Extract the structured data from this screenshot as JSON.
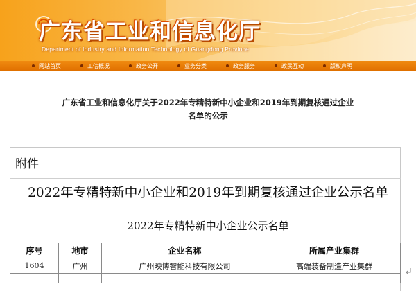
{
  "header": {
    "site_name": "广东省工业和信息化厅",
    "site_subtitle": "Department of Industry and Information Technology of Guangdong Province"
  },
  "nav": {
    "items": [
      {
        "label": "网站首页"
      },
      {
        "label": "工信概况"
      },
      {
        "label": "政务公开"
      },
      {
        "label": "业务分类"
      },
      {
        "label": "政务服务"
      },
      {
        "label": "政民互动"
      },
      {
        "label": "版权声明"
      }
    ]
  },
  "article": {
    "title_line1": "广东省工业和信息化厅关于2022年专精特新中小企业和2019年到期复核通过企业",
    "title_line2": "名单的公示"
  },
  "attachment": {
    "label": "附件",
    "heading": "2022年专精特新中小企业和2019年到期复核通过企业公示名单",
    "subheading": "2022年专精特新中小企业公示名单"
  },
  "table": {
    "headers": [
      "序号",
      "地市",
      "企业名称",
      "所属产业集群"
    ],
    "rows": [
      [
        "1604",
        "广州",
        "广州映博智能科技有限公司",
        "高端装备制造产业集群"
      ]
    ]
  }
}
